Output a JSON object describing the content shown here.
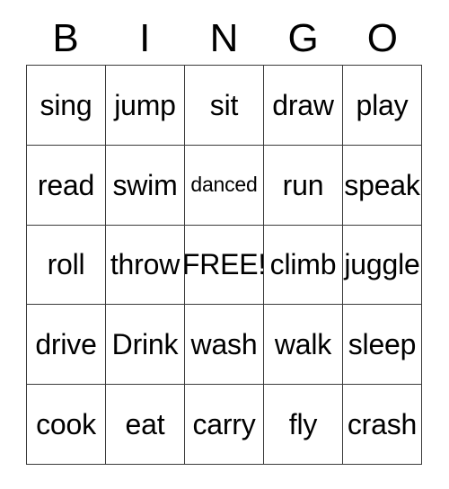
{
  "card": {
    "headers": [
      "B",
      "I",
      "N",
      "G",
      "O"
    ],
    "rows": [
      [
        {
          "label": "sing",
          "size": "normal"
        },
        {
          "label": "jump",
          "size": "normal"
        },
        {
          "label": "sit",
          "size": "normal"
        },
        {
          "label": "draw",
          "size": "normal"
        },
        {
          "label": "play",
          "size": "normal"
        }
      ],
      [
        {
          "label": "read",
          "size": "normal"
        },
        {
          "label": "swim",
          "size": "normal"
        },
        {
          "label": "danced",
          "size": "small"
        },
        {
          "label": "run",
          "size": "normal"
        },
        {
          "label": "speak",
          "size": "normal"
        }
      ],
      [
        {
          "label": "roll",
          "size": "normal"
        },
        {
          "label": "throw",
          "size": "normal"
        },
        {
          "label": "FREE!",
          "size": "normal"
        },
        {
          "label": "climb",
          "size": "normal"
        },
        {
          "label": "juggle",
          "size": "normal"
        }
      ],
      [
        {
          "label": "drive",
          "size": "normal"
        },
        {
          "label": "Drink",
          "size": "normal"
        },
        {
          "label": "wash",
          "size": "normal"
        },
        {
          "label": "walk",
          "size": "normal"
        },
        {
          "label": "sleep",
          "size": "normal"
        }
      ],
      [
        {
          "label": "cook",
          "size": "normal"
        },
        {
          "label": "eat",
          "size": "normal"
        },
        {
          "label": "carry",
          "size": "normal"
        },
        {
          "label": "fly",
          "size": "normal"
        },
        {
          "label": "crash",
          "size": "normal"
        }
      ]
    ],
    "colors": {
      "border": "#3a3a3a",
      "text": "#000000",
      "background": "#ffffff"
    }
  }
}
